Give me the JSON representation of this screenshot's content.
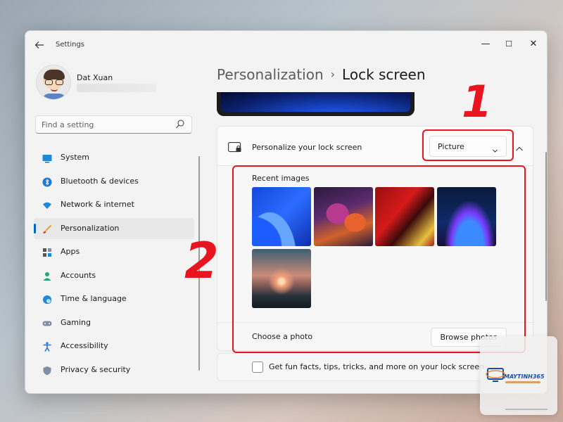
{
  "window": {
    "title": "Settings",
    "controls": {
      "minimize": "—",
      "maximize": "☐",
      "close": "✕"
    }
  },
  "profile": {
    "name": "Dat Xuan"
  },
  "search": {
    "placeholder": "Find a setting"
  },
  "sidebar": {
    "items": [
      {
        "label": "System",
        "icon": "monitor-icon"
      },
      {
        "label": "Bluetooth & devices",
        "icon": "bluetooth-icon"
      },
      {
        "label": "Network & internet",
        "icon": "wifi-icon"
      },
      {
        "label": "Personalization",
        "icon": "brush-icon",
        "active": true
      },
      {
        "label": "Apps",
        "icon": "apps-icon"
      },
      {
        "label": "Accounts",
        "icon": "person-icon"
      },
      {
        "label": "Time & language",
        "icon": "clock-globe-icon"
      },
      {
        "label": "Gaming",
        "icon": "gamepad-icon"
      },
      {
        "label": "Accessibility",
        "icon": "accessibility-icon"
      },
      {
        "label": "Privacy & security",
        "icon": "shield-icon"
      }
    ]
  },
  "breadcrumb": {
    "parent": "Personalization",
    "separator": "›",
    "current": "Lock screen"
  },
  "lock_card": {
    "title": "Personalize your lock screen",
    "dropdown_value": "Picture",
    "recent_label": "Recent images",
    "choose_label": "Choose a photo",
    "browse_label": "Browse photos"
  },
  "fun_facts": {
    "label": "Get fun facts, tips, tricks, and more on your lock screen",
    "checked": false
  },
  "annotations": {
    "one": "1",
    "two": "2"
  },
  "watermark": {
    "brand": "MAYTINH365"
  },
  "colors": {
    "accent": "#0067c0",
    "annotation": "#e8141f"
  }
}
